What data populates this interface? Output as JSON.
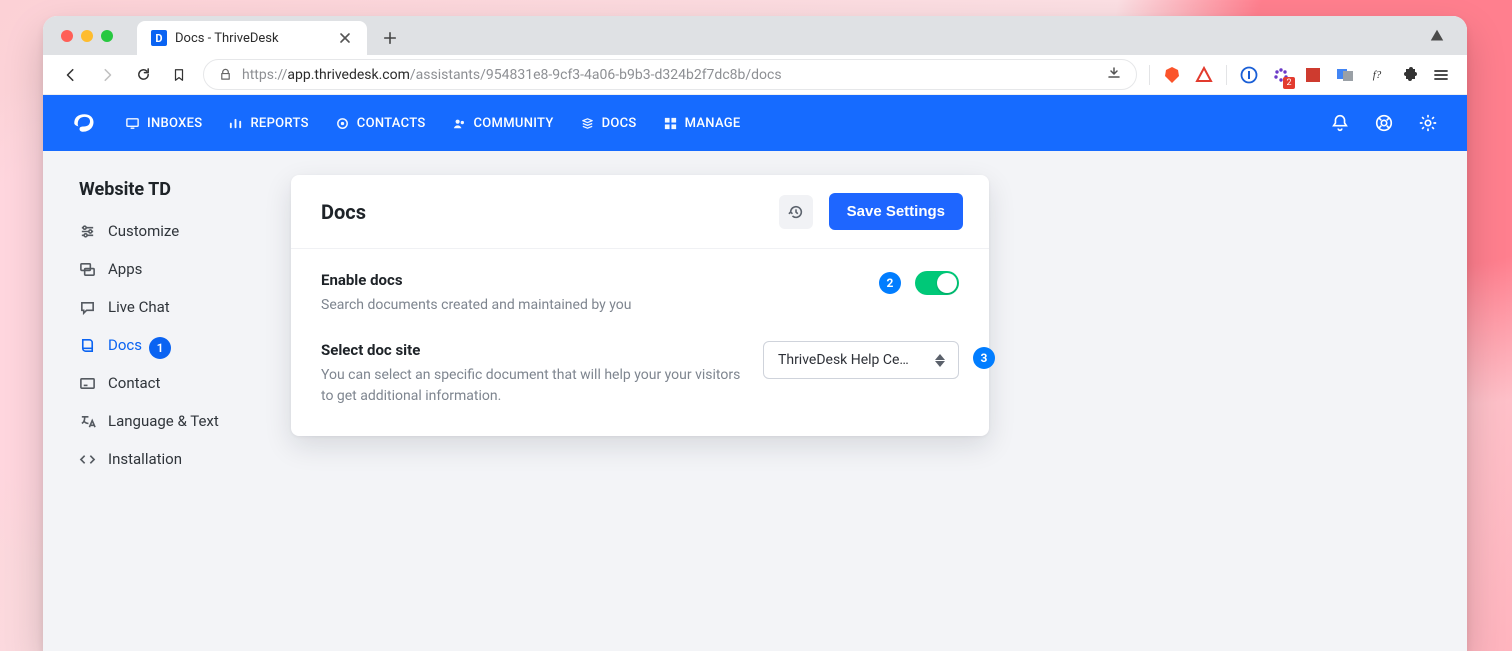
{
  "browser": {
    "tab_title": "Docs - ThriveDesk",
    "url_muted_prefix": "https://",
    "url_strong": "app.thrivedesk.com",
    "url_muted_suffix": "/assistants/954831e8-9cf3-4a06-b9b3-d324b2f7dc8b/docs"
  },
  "topnav": {
    "items": [
      "INBOXES",
      "REPORTS",
      "CONTACTS",
      "COMMUNITY",
      "DOCS",
      "MANAGE"
    ]
  },
  "sidebar": {
    "title": "Website TD",
    "items": [
      "Customize",
      "Apps",
      "Live Chat",
      "Docs",
      "Contact",
      "Language & Text",
      "Installation"
    ],
    "active_index": 3,
    "active_badge": "1"
  },
  "panel": {
    "title": "Docs",
    "save_label": "Save Settings",
    "enable": {
      "title": "Enable docs",
      "desc": "Search documents created and maintained by you",
      "on": true,
      "marker": "2"
    },
    "select_site": {
      "title": "Select doc site",
      "desc": "You can select an specific document that will help your your visitors to get additional information.",
      "selected_label": "ThriveDesk Help Ce…",
      "marker": "3"
    }
  }
}
